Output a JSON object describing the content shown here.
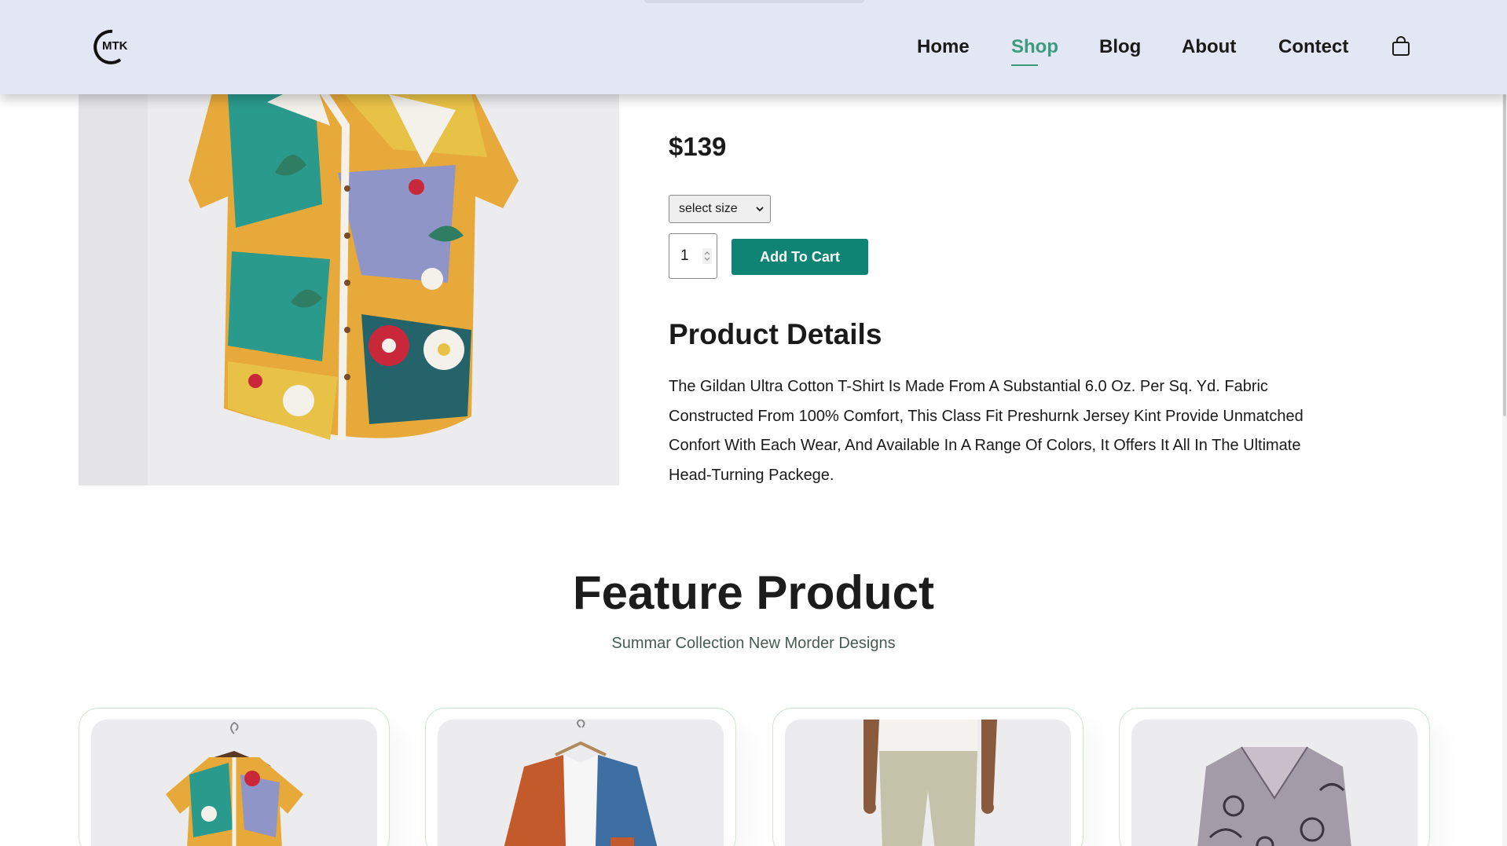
{
  "header": {
    "logo_text": "MTK",
    "nav": [
      {
        "label": "Home"
      },
      {
        "label": "Shop",
        "active": true
      },
      {
        "label": "Blog"
      },
      {
        "label": "About"
      },
      {
        "label": "Contect"
      }
    ],
    "cart_icon": "shopping-bag-icon"
  },
  "product": {
    "price": "$139",
    "size_select": {
      "selected": "select size"
    },
    "quantity": "1",
    "add_to_cart_label": "Add To Cart",
    "details_title": "Product Details",
    "details_text": "The Gildan Ultra Cotton T-Shirt Is Made From A Substantial 6.0 Oz. Per Sq. Yd. Fabric Constructed From 100% Comfort, This Class Fit Preshurnk Jersey Kint Provide Unmatched Confort With Each Wear, And Available In A Range Of Colors, It Offers It All In The Ultimate Head-Turning Packege."
  },
  "feature": {
    "title": "Feature Product",
    "subtitle": "Summar Collection New Morder Designs",
    "cards": [
      {
        "image": "floral-shirt-image"
      },
      {
        "image": "orange-blue-jacket-image"
      },
      {
        "image": "linen-pants-image"
      },
      {
        "image": "patterned-blouse-image"
      }
    ]
  },
  "colors": {
    "header_bg": "#e3e6f3",
    "accent": "#3b9b7e",
    "button_bg": "#0f8475",
    "card_border": "#cce7d0"
  }
}
